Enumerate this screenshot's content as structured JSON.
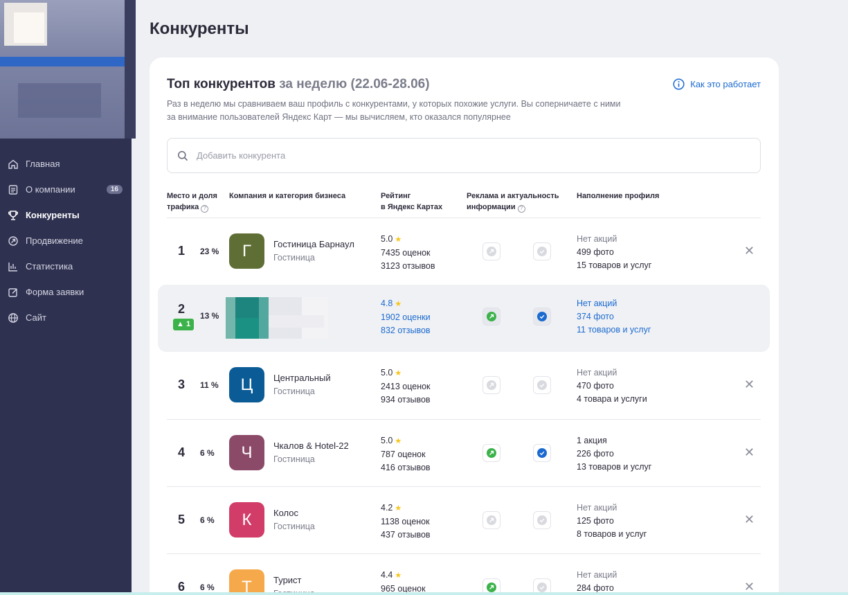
{
  "sidebar": {
    "items": [
      {
        "label": "Главная",
        "icon": "home-icon"
      },
      {
        "label": "О компании",
        "icon": "document-icon",
        "badge": "16"
      },
      {
        "label": "Конкуренты",
        "icon": "trophy-icon",
        "active": true
      },
      {
        "label": "Продвижение",
        "icon": "promo-icon"
      },
      {
        "label": "Статистика",
        "icon": "chart-icon"
      },
      {
        "label": "Форма заявки",
        "icon": "edit-icon"
      },
      {
        "label": "Сайт",
        "icon": "globe-icon"
      }
    ]
  },
  "page": {
    "title": "Конкуренты"
  },
  "card": {
    "title": "Топ конкурентов",
    "period": "за неделю (22.06-28.06)",
    "how_link": "Как это работает",
    "description": "Раз в неделю мы сравниваем ваш профиль с конкурентами, у которых похожие услуги. Вы соперничаете с ними за внимание пользователей Яндекс Карт — мы вычисляем, кто оказался популярнее",
    "search_placeholder": "Добавить конкурента"
  },
  "table": {
    "headers": {
      "place_line1": "Место и доля",
      "place_line2": "трафика",
      "company": "Компания и категория бизнеса",
      "rating_line1": "Рейтинг",
      "rating_line2": "в Яндекс Картах",
      "ads_line1": "Реклама и актуальность",
      "ads_line2": "информации",
      "profile": "Наполнение профиля"
    },
    "rows": [
      {
        "rank": "1",
        "share": "23 %",
        "letter": "Г",
        "color": "#5f6e34",
        "name": "Гостиница Барнаул",
        "category": "Гостиница",
        "rating": "5.0",
        "marks": "7435 оценок",
        "reviews": "3123 отзывов",
        "ad": false,
        "verified": false,
        "promos": "Нет акций",
        "photos": "499 фото",
        "goods": "15 товаров и услуг"
      },
      {
        "rank": "2",
        "share": "13 %",
        "trend": "1",
        "own": true,
        "rating": "4.8",
        "marks": "1902 оценки",
        "reviews": "832 отзывов",
        "ad": true,
        "verified": true,
        "promos": "Нет акций",
        "photos": "374 фото",
        "goods": "11 товаров и услуг"
      },
      {
        "rank": "3",
        "share": "11 %",
        "letter": "Ц",
        "color": "#0b5c96",
        "name": "Центральный",
        "category": "Гостиница",
        "rating": "5.0",
        "marks": "2413 оценок",
        "reviews": "934 отзывов",
        "ad": false,
        "verified": false,
        "promos": "Нет акций",
        "photos": "470 фото",
        "goods": "4 товара и услуги"
      },
      {
        "rank": "4",
        "share": "6 %",
        "letter": "Ч",
        "color": "#8c4a69",
        "name": "Чкалов & Hotel-22",
        "category": "Гостиница",
        "rating": "5.0",
        "marks": "787 оценок",
        "reviews": "416 отзывов",
        "ad": true,
        "verified": true,
        "promos": "1 акция",
        "photos": "226 фото",
        "goods": "13 товаров и услуг"
      },
      {
        "rank": "5",
        "share": "6 %",
        "letter": "К",
        "color": "#d13c68",
        "name": "Колос",
        "category": "Гостиница",
        "rating": "4.2",
        "marks": "1138 оценок",
        "reviews": "437 отзывов",
        "ad": false,
        "verified": false,
        "promos": "Нет акций",
        "photos": "125 фото",
        "goods": "8 товаров и услуг"
      },
      {
        "rank": "6",
        "share": "6 %",
        "letter": "Т",
        "color": "#f6a94a",
        "name": "Турист",
        "category": "Гостиница",
        "rating": "4.4",
        "marks": "965 оценок",
        "reviews": "",
        "ad": true,
        "verified": false,
        "promos": "Нет акций",
        "photos": "284 фото",
        "goods": ""
      }
    ]
  },
  "colors": {
    "accent": "#1b6ad0",
    "sidebar": "#2f3150",
    "green": "#3bb24a"
  }
}
